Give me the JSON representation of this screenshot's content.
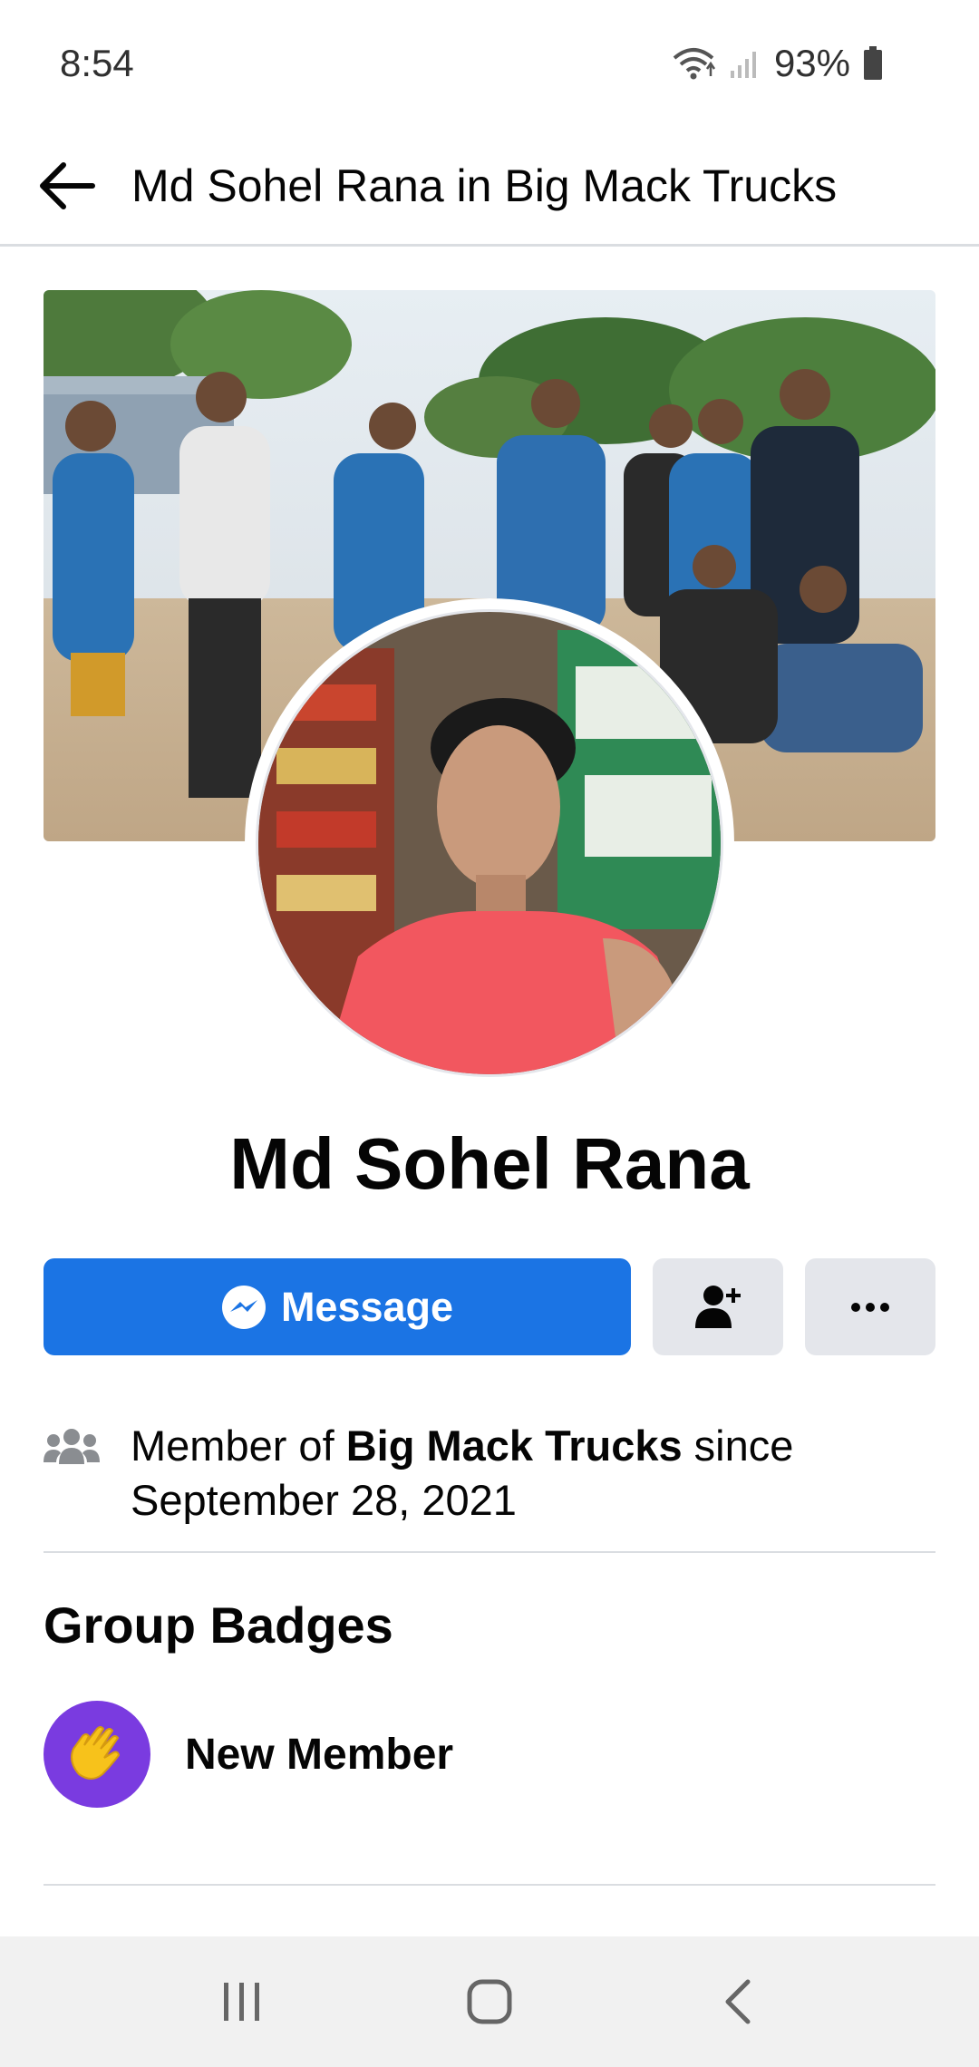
{
  "status_bar": {
    "time": "8:54",
    "battery": "93%",
    "icons": [
      "wifi-icon",
      "signal-icon",
      "battery-icon"
    ]
  },
  "app_bar": {
    "title": "Md Sohel Rana in Big Mack Trucks",
    "back_icon": "arrow-left-icon"
  },
  "profile": {
    "name": "Md Sohel Rana"
  },
  "actions": {
    "message_label": "Message",
    "message_icon": "messenger-icon",
    "add_friend_icon": "add-friend-icon",
    "more_icon": "more-dots-icon"
  },
  "membership": {
    "prefix": "Member of ",
    "group": "Big Mack Trucks",
    "middle": " since",
    "date": "September 28, 2021",
    "icon": "group-icon"
  },
  "badges": {
    "title": "Group Badges",
    "items": [
      {
        "label": "New Member",
        "icon": "waving-hand-icon"
      }
    ]
  },
  "colors": {
    "accent": "#1b74e4",
    "button_grey": "#e4e6eb",
    "badge_purple": "#7a3be0",
    "badge_hand": "#f7c21b"
  },
  "nav_bar": {
    "icons": [
      "recent-apps-icon",
      "home-icon",
      "back-icon"
    ]
  }
}
